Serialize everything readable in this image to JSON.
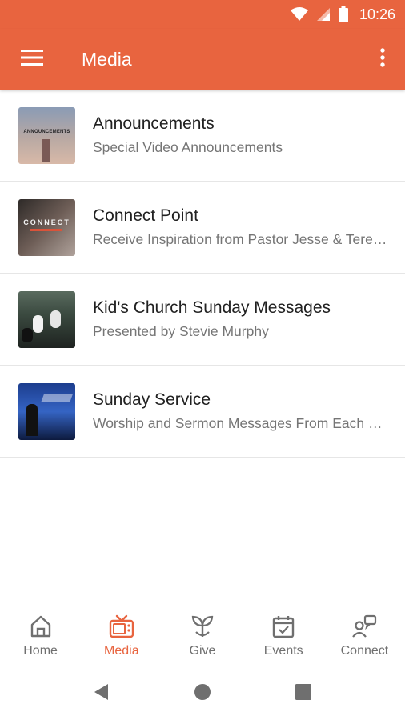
{
  "status_bar": {
    "time": "10:26",
    "icons": [
      "wifi-icon",
      "cellular-signal-icon",
      "battery-icon"
    ]
  },
  "app_bar": {
    "title": "Media",
    "left_icon": "hamburger-menu-icon",
    "right_icon": "more-vert-icon"
  },
  "colors": {
    "primary": "#e8643f",
    "title_text": "#212121",
    "subtitle_text": "#757575",
    "nav_inactive": "#6f6f6f"
  },
  "media_items": [
    {
      "title": "Announcements",
      "subtitle": "Special Video Announcements",
      "thumbnail_text": "ANNOUNCEMENTS"
    },
    {
      "title": "Connect Point",
      "subtitle": "Receive Inspiration from Pastor Jesse & Teresa Woods",
      "thumbnail_text": "CONNECT"
    },
    {
      "title": "Kid's Church Sunday Messages",
      "subtitle": "Presented by Stevie Murphy"
    },
    {
      "title": "Sunday Service",
      "subtitle": "Worship and Sermon Messages From Each Sunday"
    }
  ],
  "bottom_nav": {
    "tabs": [
      {
        "label": "Home",
        "icon": "home-icon",
        "active": false
      },
      {
        "label": "Media",
        "icon": "tv-icon",
        "active": true
      },
      {
        "label": "Give",
        "icon": "sprout-icon",
        "active": false
      },
      {
        "label": "Events",
        "icon": "calendar-check-icon",
        "active": false
      },
      {
        "label": "Connect",
        "icon": "connect-people-icon",
        "active": false
      }
    ]
  },
  "system_nav": {
    "buttons": [
      "back-icon",
      "home-circle-icon",
      "recents-icon"
    ]
  }
}
